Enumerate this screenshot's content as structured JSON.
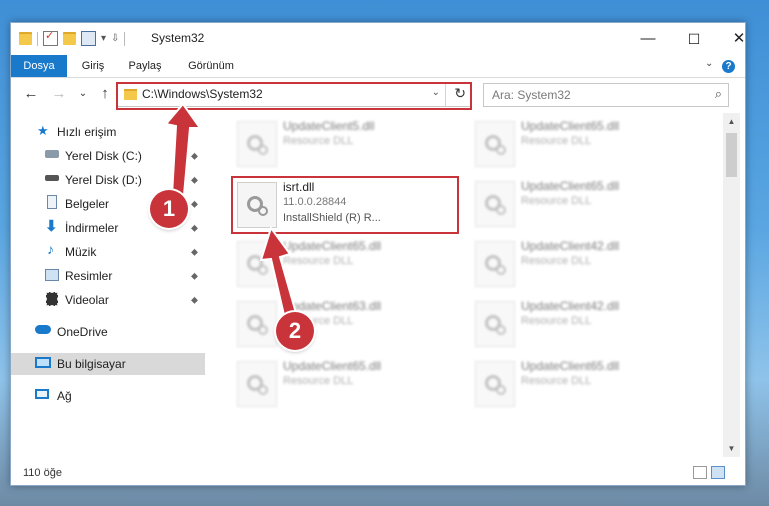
{
  "window": {
    "title": "System32",
    "quick_access_chevron": "▾",
    "minimize": "—",
    "maximize": "☐",
    "close": "✕"
  },
  "ribbon": {
    "tabs": [
      "Dosya",
      "Giriş",
      "Paylaş",
      "Görünüm"
    ],
    "help": "?",
    "expand": "⌄"
  },
  "nav": {
    "back": "←",
    "forward": "→",
    "recent": "⌄",
    "up": "↑",
    "address": "C:\\Windows\\System32",
    "address_dropdown": "⌄",
    "refresh": "↻",
    "search_placeholder": "Ara: System32",
    "search_icon": "⌕"
  },
  "sidebar": {
    "items": [
      {
        "label": "Hızlı erişim",
        "icon": "star-icon",
        "pinned": false
      },
      {
        "label": "Yerel Disk (C:)",
        "icon": "drive-icon",
        "pinned": true
      },
      {
        "label": "Yerel Disk (D:)",
        "icon": "drive-icon",
        "pinned": true
      },
      {
        "label": "Belgeler",
        "icon": "documents-icon",
        "pinned": true
      },
      {
        "label": "İndirmeler",
        "icon": "downloads-icon",
        "pinned": true
      },
      {
        "label": "Müzik",
        "icon": "music-icon",
        "pinned": true
      },
      {
        "label": "Resimler",
        "icon": "pictures-icon",
        "pinned": true
      },
      {
        "label": "Videolar",
        "icon": "videos-icon",
        "pinned": true
      },
      {
        "label": "OneDrive",
        "icon": "cloud-icon",
        "pinned": false
      },
      {
        "label": "Bu bilgisayar",
        "icon": "computer-icon",
        "pinned": false,
        "selected": true
      },
      {
        "label": "Ağ",
        "icon": "network-icon",
        "pinned": false
      }
    ],
    "pin_glyph": "📌"
  },
  "files": {
    "left": [
      {
        "name": "UpdateClient5.dll",
        "type": "Resource DLL"
      },
      {
        "name": "isrt.dll",
        "version": "11.0.0.28844",
        "description": "InstallShield (R) R...",
        "highlighted": true
      },
      {
        "name": "UpdateClient65.dll",
        "type": "Resource DLL"
      },
      {
        "name": "UpdateClient63.dll",
        "type": "Resource DLL"
      },
      {
        "name": "UpdateClient65.dll",
        "type": "Resource DLL"
      }
    ],
    "right": [
      {
        "name": "UpdateClient65.dll",
        "type": "Resource DLL"
      },
      {
        "name": "UpdateClient65.dll",
        "type": "Resource DLL"
      },
      {
        "name": "UpdateClient42.dll",
        "type": "Resource DLL"
      },
      {
        "name": "UpdateClient42.dll",
        "type": "Resource DLL"
      },
      {
        "name": "UpdateClient65.dll",
        "type": "Resource DLL"
      }
    ]
  },
  "status": {
    "item_count": "110 öğe"
  },
  "annotations": {
    "step1": "1",
    "step2": "2",
    "color": "#c9333a"
  }
}
